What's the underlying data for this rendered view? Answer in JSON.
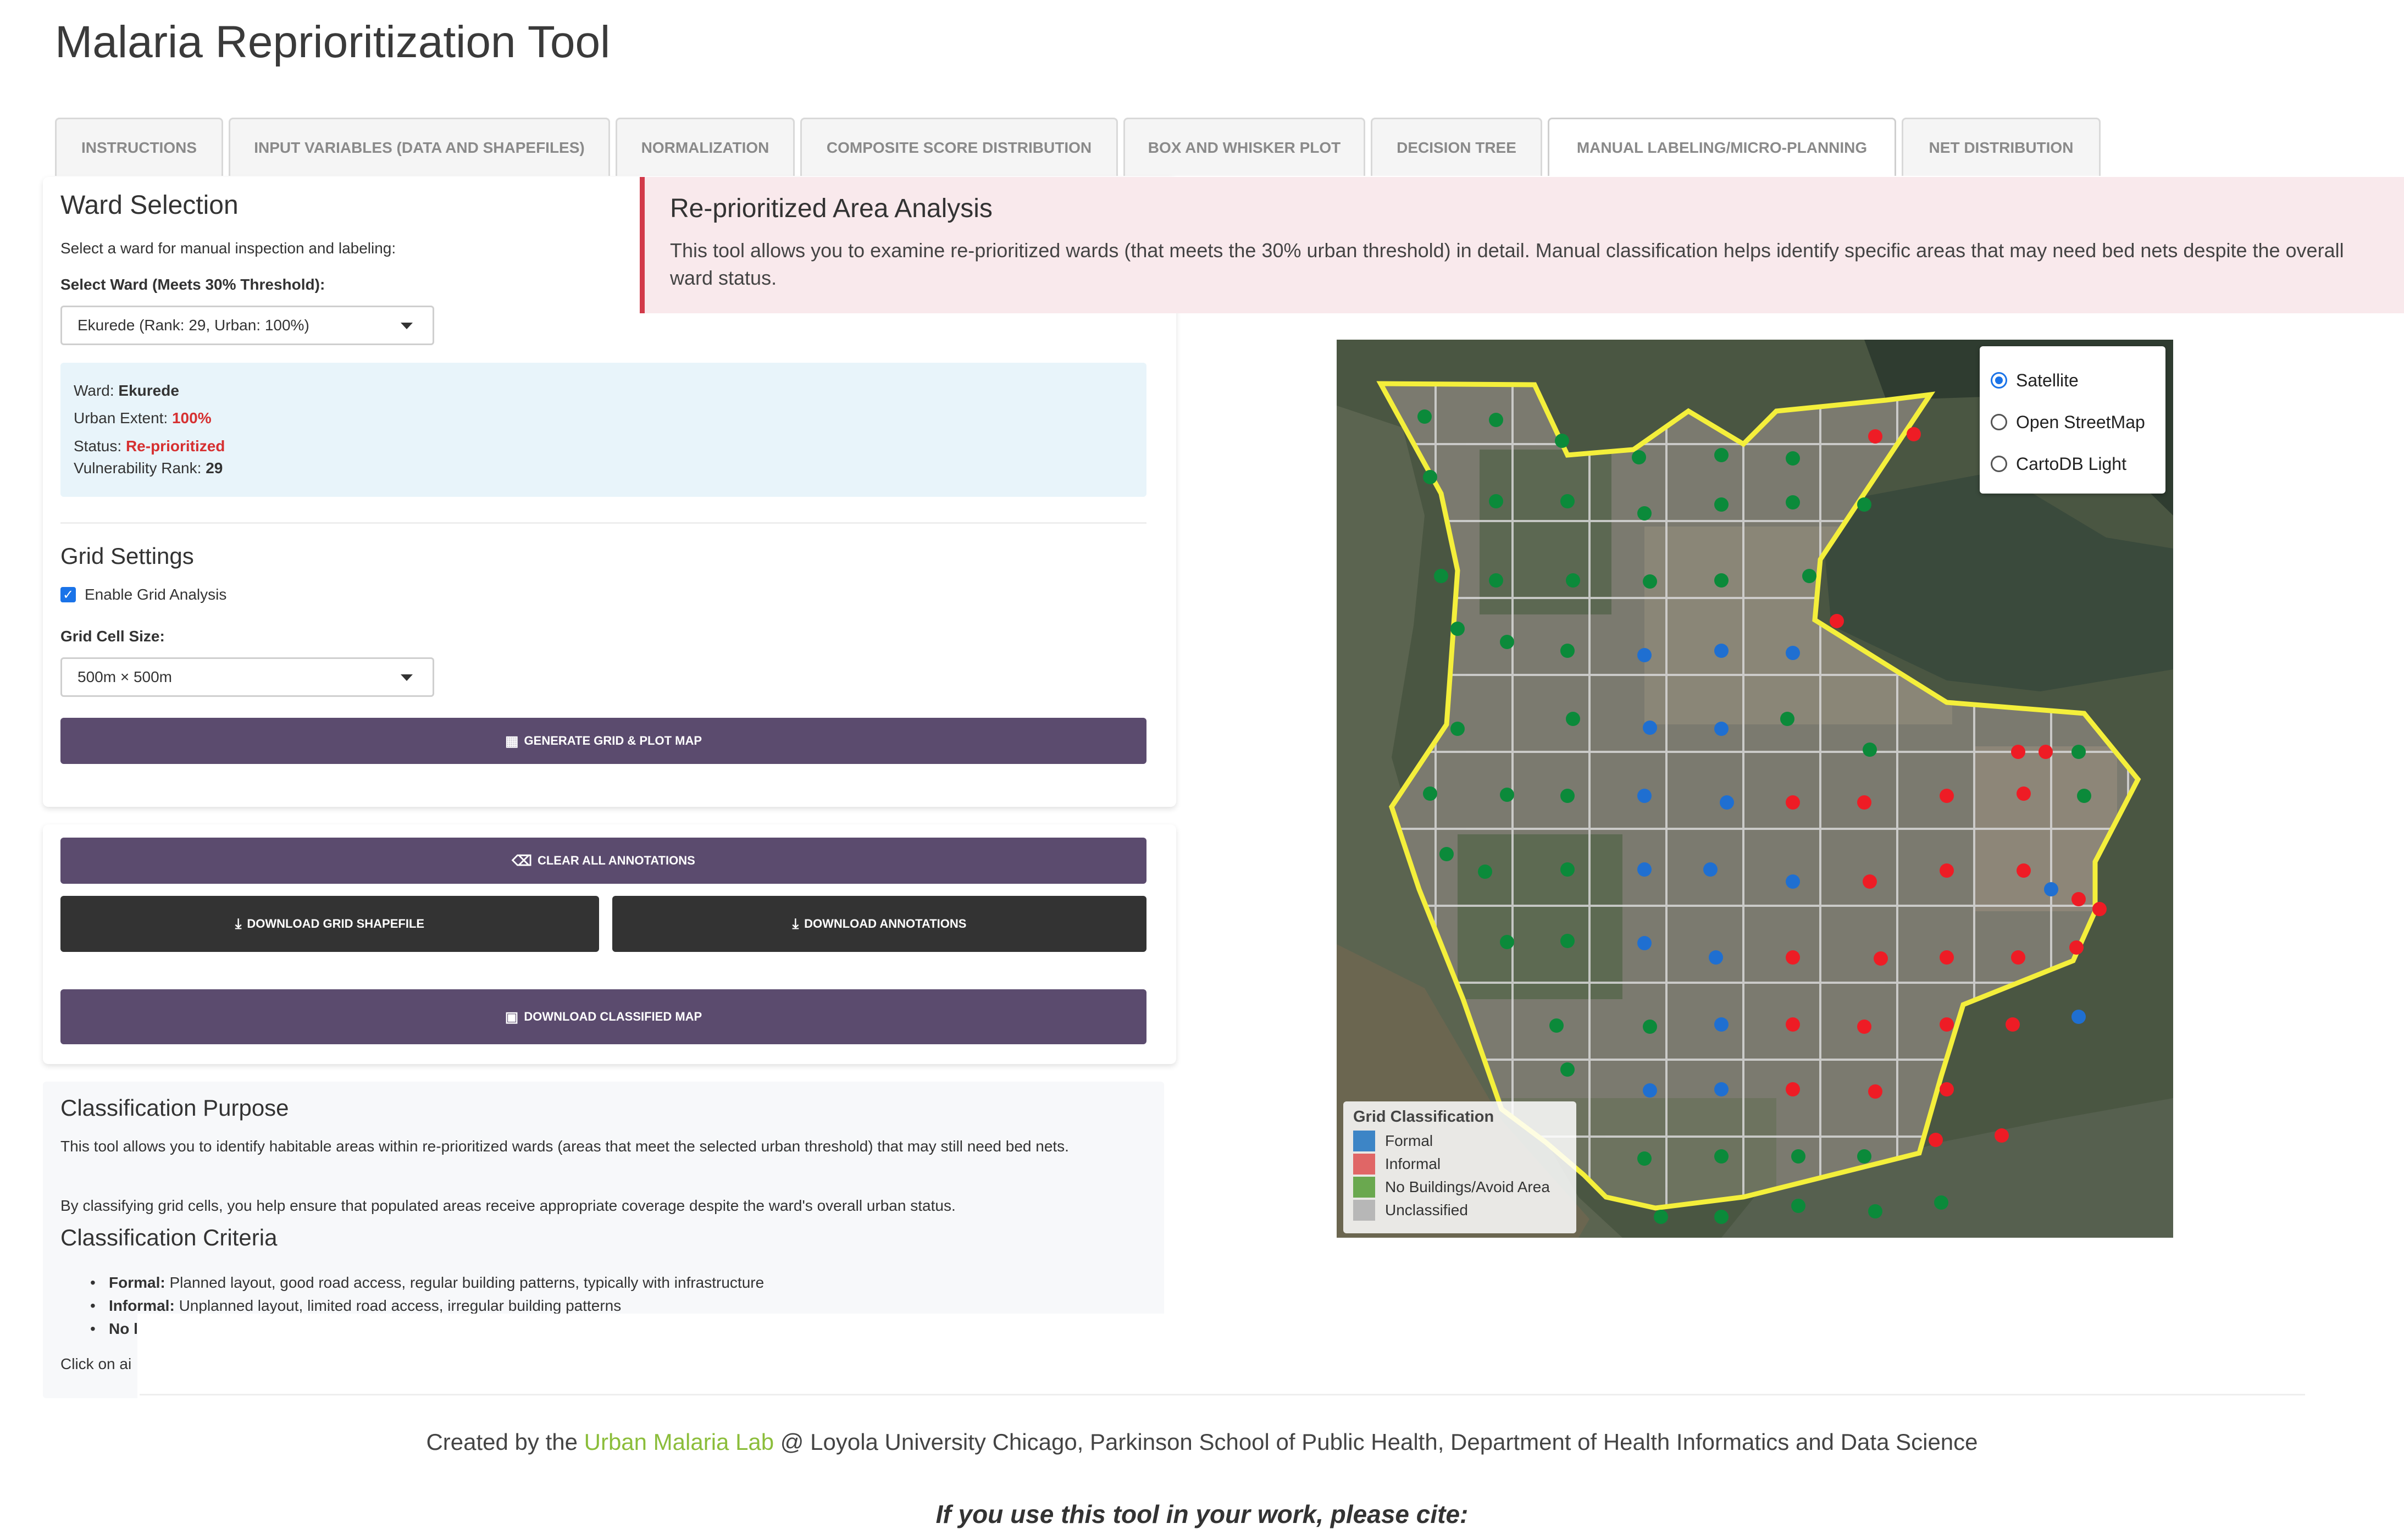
{
  "app": {
    "title": "Malaria Reprioritization Tool"
  },
  "tabs": [
    {
      "label": "Instructions"
    },
    {
      "label": "Input Variables (Data and Shapefiles)"
    },
    {
      "label": "Normalization"
    },
    {
      "label": "Composite Score Distribution"
    },
    {
      "label": "Box and Whisker Plot"
    },
    {
      "label": "Decision Tree"
    },
    {
      "label": "Manual Labeling/Micro-Planning"
    },
    {
      "label": "Net Distribution"
    }
  ],
  "ward_selection": {
    "title": "Ward Selection",
    "subtitle": "Select a ward for manual inspection and labeling:",
    "select_label": "Select Ward (Meets 30% Threshold):",
    "select_value": "Ekurede (Rank: 29, Urban: 100%)",
    "info": {
      "ward_label": "Ward:",
      "ward_value": "Ekurede",
      "urban_label": "Urban Extent:",
      "urban_value": "100%",
      "status_label": "Status:",
      "status_value": "Re-prioritized",
      "rank_label": "Vulnerability Rank:",
      "rank_value": "29"
    }
  },
  "grid_settings": {
    "title": "Grid Settings",
    "enable_label": "Enable Grid Analysis",
    "enable_checked": true,
    "cell_size_label": "Grid Cell Size:",
    "cell_size_value": "500m × 500m",
    "generate_button": "Generate Grid & Plot Map"
  },
  "actions": {
    "clear_button": "Clear All Annotations",
    "download_grid_button": "Download Grid Shapefile",
    "download_annotations_button": "Download Annotations",
    "download_map_button": "Download Classified Map"
  },
  "alert": {
    "title": "Re-prioritized Area Analysis",
    "text": "This tool allows you to examine re-prioritized wards (that meets the 30% urban threshold) in detail. Manual classification helps identify specific areas that may need bed nets despite the overall ward status."
  },
  "map": {
    "layers": [
      {
        "label": "Satellite",
        "selected": true
      },
      {
        "label": "Open StreetMap",
        "selected": false
      },
      {
        "label": "CartoDB Light",
        "selected": false
      }
    ],
    "legend": {
      "title": "Grid Classification",
      "items": [
        {
          "label": "Formal",
          "color": "#3d85c6"
        },
        {
          "label": "Informal",
          "color": "#e06666"
        },
        {
          "label": "No Buildings/Avoid Area",
          "color": "#6aa84f"
        },
        {
          "label": "Unclassified",
          "color": "#b7b7b7"
        }
      ]
    },
    "colors": {
      "boundary": "#f4ef3b",
      "formal": "#1f6fd1",
      "informal": "#ee1c25",
      "no_buildings": "#0b8a3a"
    }
  },
  "classification": {
    "title": "Classification Purpose",
    "p1": "This tool allows you to identify habitable areas within re-prioritized wards (areas that meet the selected urban threshold) that may still need bed nets.",
    "p2": "By classifying grid cells, you help ensure that populated areas receive appropriate coverage despite the ward's overall urban status.",
    "criteria_title": "Classification Criteria",
    "criteria": [
      {
        "term": "Formal:",
        "desc": "Planned layout, good road access, regular building patterns, typically with infrastructure"
      },
      {
        "term": "Informal:",
        "desc": "Unplanned layout, limited road access, irregular building patterns"
      },
      {
        "term": "No l",
        "desc": ""
      }
    ],
    "click_note": "Click on ai"
  },
  "footer": {
    "prefix": "Created by the ",
    "lab": "Urban Malaria Lab",
    "suffix": " @ Loyola University Chicago, Parkinson School of Public Health, Department of Health Informatics and Data Science",
    "cite": "If you use this tool in your work, please cite:"
  }
}
